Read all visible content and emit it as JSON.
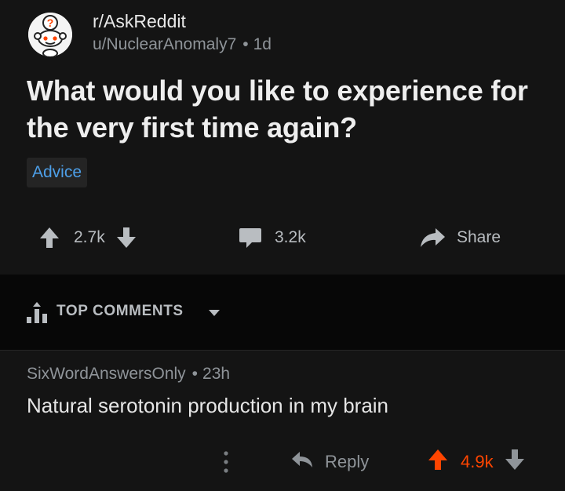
{
  "post": {
    "subreddit": "r/AskReddit",
    "author": "u/NuclearAnomaly7",
    "age": "1d",
    "title": "What would you like to experience for the very first time again?",
    "flair": "Advice",
    "upvotes": "2.7k",
    "comments": "3.2k",
    "share_label": "Share"
  },
  "sort_bar": {
    "label": "TOP COMMENTS"
  },
  "comment": {
    "author": "SixWordAnswersOnly",
    "age": "23h",
    "body": "Natural serotonin production in my brain",
    "reply_label": "Reply",
    "score": "4.9k"
  },
  "colors": {
    "background": "#141414",
    "sort_bar_bg": "#070707",
    "flair_text": "#4d9fe8",
    "upvoted": "#ff4500",
    "muted_text": "#8f9499"
  },
  "icons": [
    "askreddit-snoo-icon",
    "upvote-icon",
    "downvote-icon",
    "comment-icon",
    "share-icon",
    "sort-icon",
    "chevron-down-icon",
    "more-icon",
    "reply-icon"
  ]
}
